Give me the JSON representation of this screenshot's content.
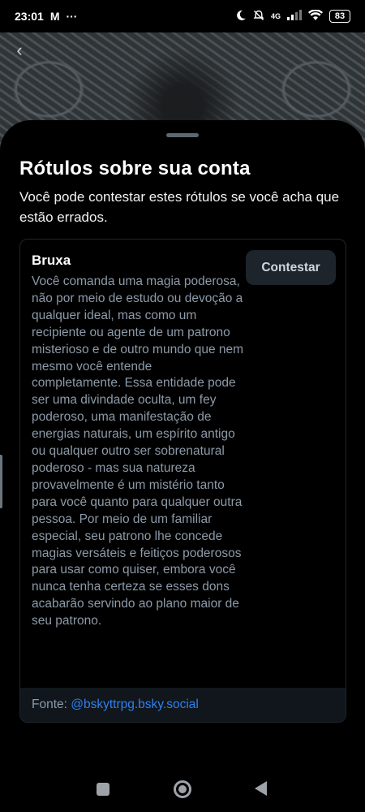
{
  "status_bar": {
    "time": "23:01",
    "mail_icon": "M",
    "more": "···",
    "network": "4G",
    "battery": "83"
  },
  "sheet": {
    "title": "Rótulos sobre sua conta",
    "subtitle": "Você pode contestar estes rótulos se você acha que estão errados."
  },
  "label": {
    "name": "Bruxa",
    "description": "Você comanda uma magia poderosa, não por meio de estudo ou devoção a qualquer ideal, mas como um recipiente ou agente de um patrono misterioso e de outro mundo que nem mesmo você entende completamente. Essa entidade pode ser uma divindade oculta, um fey poderoso, uma manifestação de energias naturais, um espírito antigo ou qualquer outro ser sobrenatural poderoso - mas sua natureza provavelmente é um mistério tanto para você quanto para qualquer outra pessoa. Por meio de um familiar especial, seu patrono lhe concede magias versáteis e feitiços poderosos para usar como quiser, embora você nunca tenha certeza se esses dons acabarão servindo ao plano maior de seu patrono.",
    "contest_label": "Contestar",
    "source_prefix": "Fonte: ",
    "source_handle": "@bskyttrpg.bsky.social"
  },
  "colors": {
    "background": "#000000",
    "muted_text": "#8d9aa8",
    "link": "#2f80ed",
    "button_bg": "#1d242b",
    "source_bg": "#10161c"
  }
}
